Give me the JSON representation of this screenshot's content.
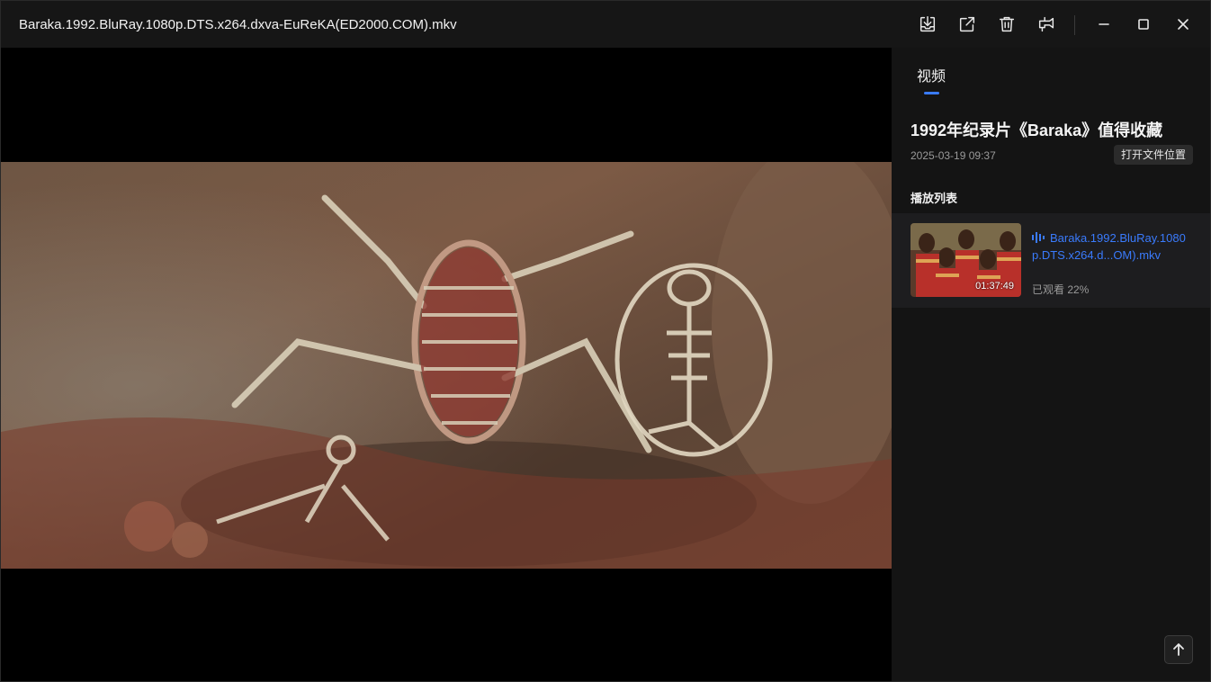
{
  "window": {
    "title": "Baraka.1992.BluRay.1080p.DTS.x264.dxva-EuReKA(ED2000.COM).mkv"
  },
  "toolbar": {
    "icons": [
      "download-icon",
      "open-external-icon",
      "trash-icon",
      "pin-icon"
    ],
    "window_controls": [
      "minimize-icon",
      "maximize-icon",
      "close-icon"
    ]
  },
  "sidebar": {
    "tab_label": "视频",
    "accent_color": "#3a7bfd",
    "video_title": "1992年纪录片《Baraka》值得收藏",
    "video_date": "2025-03-19 09:37",
    "open_location_label": "打开文件位置",
    "playlist_title": "播放列表",
    "playlist": [
      {
        "name": "Baraka.1992.BluRay.1080p.DTS.x264.d...OM).mkv",
        "duration": "01:37:49",
        "watched": "已观看 22%",
        "playing": true
      }
    ]
  }
}
